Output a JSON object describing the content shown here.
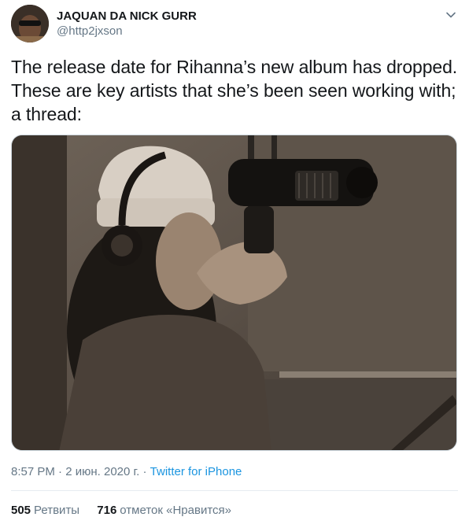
{
  "user": {
    "display_name": "JAQUAN DA NICK GURR",
    "handle": "@http2jxson"
  },
  "tweet": {
    "text": "The release date for Rihanna’s new album has dropped. These are key artists that she’s been seen working with; a thread:",
    "time": "8:57 PM",
    "date": "2 июн. 2020 г.",
    "separator": "·",
    "source": "Twitter for iPhone"
  },
  "stats": {
    "retweets_count": "505",
    "retweets_label": "Ретвиты",
    "likes_count": "716",
    "likes_label": "отметок «Нравится»"
  },
  "icons": {
    "caret": "chevron-down-icon"
  },
  "colors": {
    "link": "#1b95e0",
    "secondary_text": "#657786",
    "primary_text": "#14171a"
  }
}
